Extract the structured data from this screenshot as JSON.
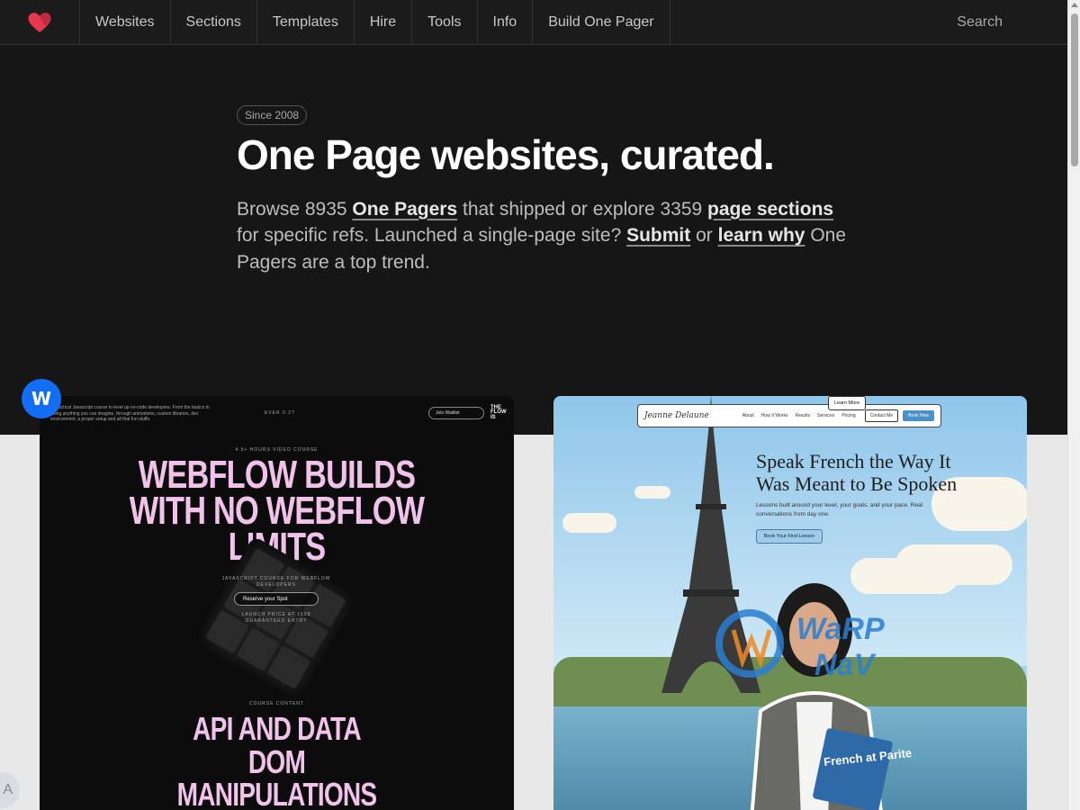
{
  "nav": {
    "items": [
      "Websites",
      "Sections",
      "Templates",
      "Hire",
      "Tools",
      "Info",
      "Build One Pager"
    ],
    "search_label": "Search"
  },
  "hero": {
    "badge": "Since 2008",
    "title": "One Page websites, curated.",
    "lead_1": "Browse 8935 ",
    "link_one_pagers": "One Pagers",
    "lead_2": " that shipped or explore 3359 ",
    "link_sections": "page sections",
    "lead_3": " for specific refs. Launched a single-page site? ",
    "link_submit": "Submit",
    "lead_4": " or ",
    "link_learn": "learn why",
    "lead_5": " One Pagers are a top trend."
  },
  "card_left": {
    "badge_letter": "W",
    "top_text": "A practical Javascript course to level up no-code developers. From the basics to doing anything you can imagine, through animations, custom libraries, dev environment, a proper setup and all that fun stuffs.",
    "ever_text": "EVER 0.2?",
    "join": "Join Waitlist",
    "logo": "THE FLOW IS",
    "video_course": "4.5+ HOURS VIDEO COURSE",
    "headline_1": "WEBFLOW BUILDS",
    "headline_2": "WITH NO WEBFLOW",
    "headline_3": "LIMITS",
    "js_course": "JAVASCRIPT COURSE FOR WEBFLOW DEVELOPERS",
    "reserve": "Reserve your Spot",
    "launch": "LAUNCH PRICE AT 169$ GUARANTEED ENTRY",
    "course_content": "COURSE CONTENT",
    "topic_1": "API AND DATA",
    "topic_2": "DOM",
    "topic_3": "MANIPULATIONS"
  },
  "card_right": {
    "brand": "Jeanne Delaune",
    "nav_links": [
      "About",
      "How It Works",
      "Results",
      "Services",
      "Pricing"
    ],
    "contact": "Contact Me",
    "book": "Book Now",
    "headline": "Speak French the Way It Was Meant to Be Spoken",
    "sub": "Lessons built around your level, your goals, and your pace. Real conversations from day one.",
    "btn_primary": "Book Your First Lesson",
    "btn_secondary": "Learn More",
    "book_title": "French at Parite"
  },
  "colors": {
    "page_bg": "#161616",
    "accent_pink": "#f2c3ea",
    "webflow_blue": "#146ef5",
    "logo_red": "#e8384f"
  }
}
